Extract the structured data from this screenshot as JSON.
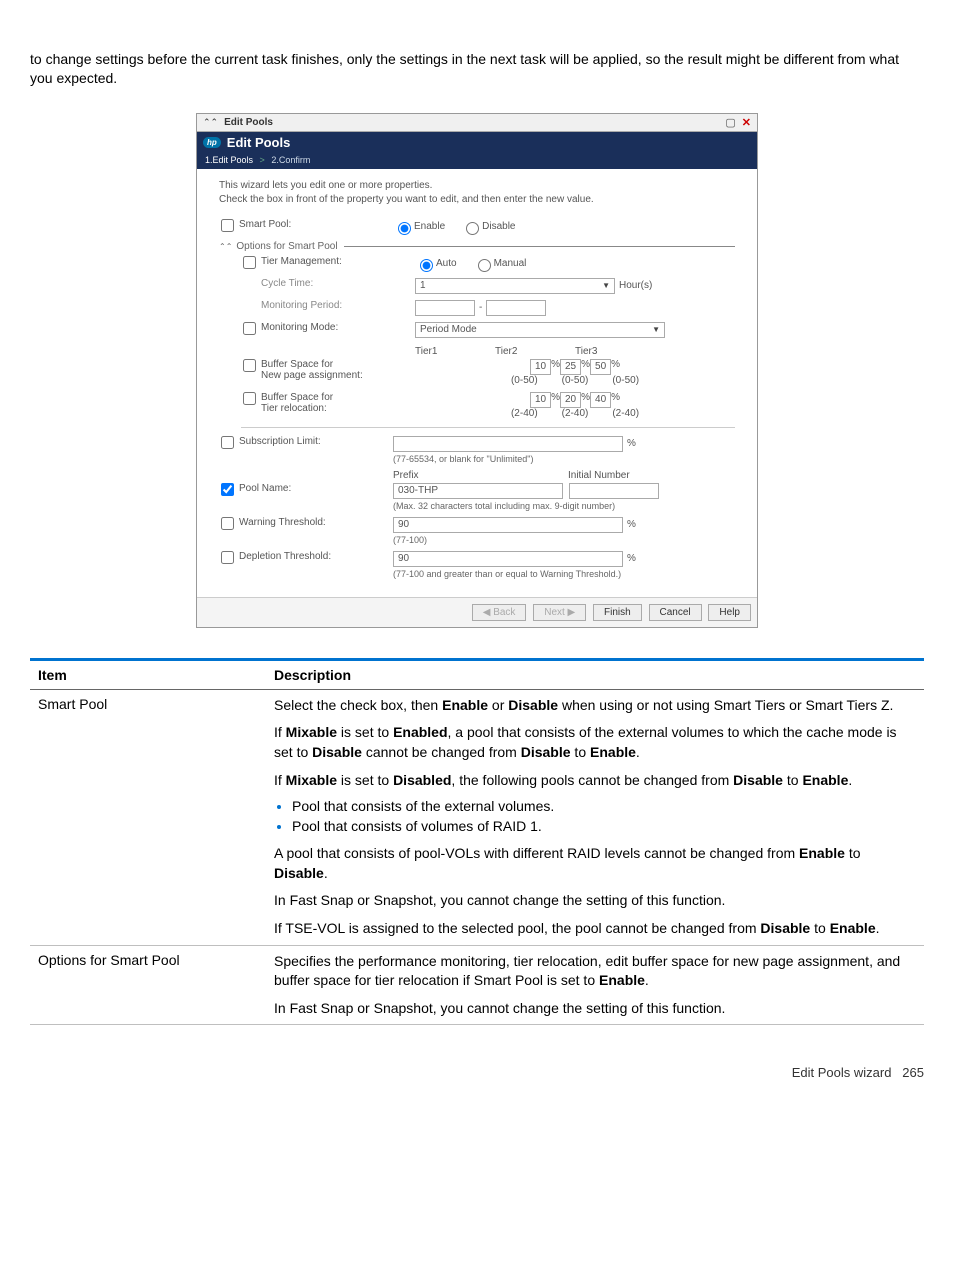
{
  "intro_paragraph": "to change settings before the current task finishes, only the settings in the next task will be applied, so the result might be different from what you expected.",
  "shot": {
    "titlebar": "Edit Pools",
    "header_title": "Edit Pools",
    "breadcrumb": {
      "step1": "1.Edit Pools",
      "sep": ">",
      "step2": "2.Confirm"
    },
    "desc1": "This wizard lets you edit one or more properties.",
    "desc2": "Check the box in front of the property you want to edit, and then enter the new value.",
    "smart_pool_label": "Smart Pool:",
    "enable_label": "Enable",
    "disable_label": "Disable",
    "options_hdr": "Options for Smart Pool",
    "tier_mgmt_label": "Tier Management:",
    "auto_label": "Auto",
    "manual_label": "Manual",
    "cycle_time_label": "Cycle Time:",
    "cycle_time_value": "1",
    "cycle_time_unit": "Hour(s)",
    "monitoring_period_label": "Monitoring Period:",
    "monitoring_period_dash": "-",
    "monitoring_mode_label": "Monitoring Mode:",
    "monitoring_mode_value": "Period Mode",
    "tier1": "Tier1",
    "tier2": "Tier2",
    "tier3": "Tier3",
    "buf_new_label_a": "Buffer Space for",
    "buf_new_label_b": "New page assignment:",
    "buf_new_v1": "10",
    "buf_new_v2": "25",
    "buf_new_v3": "50",
    "buf_new_rng": "(0-50)",
    "buf_rel_label_a": "Buffer Space for",
    "buf_rel_label_b": "Tier relocation:",
    "buf_rel_v1": "10",
    "buf_rel_v2": "20",
    "buf_rel_v3": "40",
    "buf_rel_rng": "(2-40)",
    "sub_limit_label": "Subscription Limit:",
    "sub_limit_hint": "(77-65534, or blank for \"Unlimited\")",
    "prefix_label": "Prefix",
    "initial_num_label": "Initial Number",
    "pool_name_label": "Pool Name:",
    "pool_name_value": "030-THP",
    "pool_name_hint": "(Max. 32 characters total including max. 9-digit number)",
    "warn_thr_label": "Warning Threshold:",
    "warn_thr_value": "90",
    "warn_thr_hint": "(77-100)",
    "dep_thr_label": "Depletion Threshold:",
    "dep_thr_value": "90",
    "dep_thr_hint": "(77-100 and greater than or equal to Warning Threshold.)",
    "pct": "%",
    "btn_back": "◀ Back",
    "btn_next": "Next ▶",
    "btn_finish": "Finish",
    "btn_cancel": "Cancel",
    "btn_help": "Help"
  },
  "table": {
    "hdr_item": "Item",
    "hdr_desc": "Description",
    "row1_item": "Smart Pool",
    "row1_p1a": "Select the check box, then ",
    "row1_p1b": "Enable",
    "row1_p1c": " or ",
    "row1_p1d": "Disable",
    "row1_p1e": " when using or not using Smart Tiers or Smart Tiers Z.",
    "row1_p2a": "If ",
    "row1_p2b": "Mixable",
    "row1_p2c": " is set to ",
    "row1_p2d": "Enabled",
    "row1_p2e": ", a pool that consists of the external volumes to which the cache mode is set to ",
    "row1_p2f": "Disable",
    "row1_p2g": " cannot be changed from ",
    "row1_p2h": "Disable",
    "row1_p2i": " to ",
    "row1_p2j": "Enable",
    "row1_p2k": ".",
    "row1_p3a": "If ",
    "row1_p3b": "Mixable",
    "row1_p3c": " is set to ",
    "row1_p3d": "Disabled",
    "row1_p3e": ", the following pools cannot be changed from ",
    "row1_p3f": "Disable",
    "row1_p3g": " to ",
    "row1_p3h": "Enable",
    "row1_p3i": ".",
    "row1_li1": "Pool that consists of the external volumes.",
    "row1_li2": "Pool that consists of volumes of RAID 1.",
    "row1_p4a": "A pool that consists of pool-VOLs with different RAID levels cannot be changed from ",
    "row1_p4b": "Enable",
    "row1_p4c": " to ",
    "row1_p4d": "Disable",
    "row1_p4e": ".",
    "row1_p5": "In Fast Snap or Snapshot, you cannot change the setting of this function.",
    "row1_p6a": "If TSE-VOL is assigned to the selected pool, the pool cannot be changed from ",
    "row1_p6b": "Disable",
    "row1_p6c": " to ",
    "row1_p6d": "Enable",
    "row1_p6e": ".",
    "row2_item": "Options for Smart Pool",
    "row2_p1a": "Specifies the performance monitoring, tier relocation, edit buffer space for new page assignment, and buffer space for tier relocation if Smart Pool is set to ",
    "row2_p1b": "Enable",
    "row2_p1c": ".",
    "row2_p2": "In Fast Snap or Snapshot, you cannot change the setting of this function."
  },
  "footer": {
    "text": "Edit Pools wizard",
    "page": "265"
  }
}
